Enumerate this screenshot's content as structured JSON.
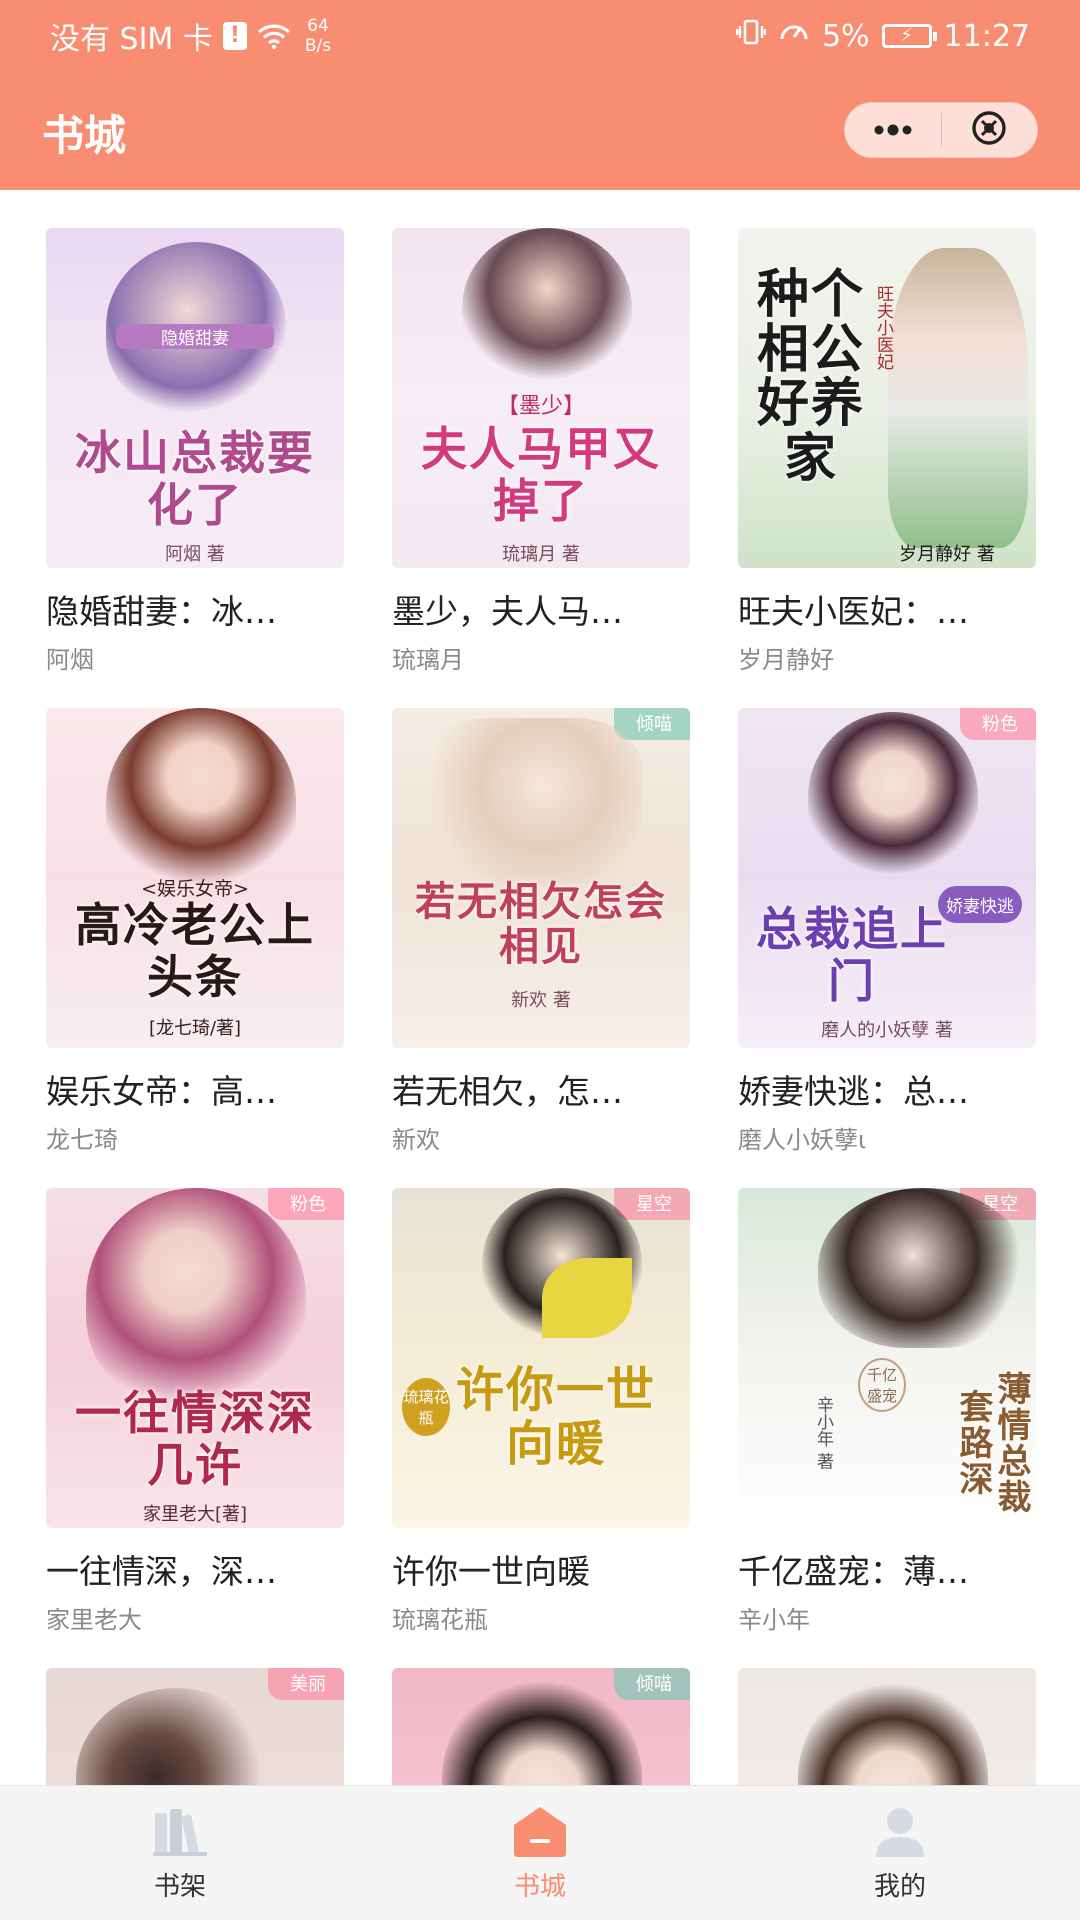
{
  "status_bar": {
    "carrier": "没有 SIM 卡",
    "sim_alert": "!",
    "net_speed_value": "64",
    "net_speed_unit": "B/s",
    "battery_percent": "5%",
    "time": "11:27"
  },
  "header": {
    "title": "书城",
    "more_icon": "more-dots-icon",
    "close_icon": "close-circle-icon"
  },
  "colors": {
    "accent": "#f98d72",
    "title_text": "#222222",
    "author_text": "#8a8a8a"
  },
  "books": [
    {
      "title": "隐婚甜妻：冰…",
      "author": "阿烟",
      "cover_title": "冰山总裁要化了",
      "cover_series": "隐婚甜妻",
      "cover_author": "阿烟 著",
      "cover_tag": ""
    },
    {
      "title": "墨少，夫人马…",
      "author": "琉璃月",
      "cover_title": "夫人马甲又掉了",
      "cover_series": "【墨少】",
      "cover_author": "琉璃月 著",
      "cover_tag": ""
    },
    {
      "title": "旺夫小医妃：…",
      "author": "岁月静好",
      "cover_title": "种个相公好养家",
      "cover_series": "旺夫小医妃",
      "cover_author": "岁月静好 著",
      "cover_tag": ""
    },
    {
      "title": "娱乐女帝：高…",
      "author": "龙七琦",
      "cover_title": "高冷老公上头条",
      "cover_series": "<娱乐女帝>",
      "cover_author": "[龙七琦/著]",
      "cover_tag": ""
    },
    {
      "title": "若无相欠，怎…",
      "author": "新欢",
      "cover_title": "若无相欠怎会相见",
      "cover_series": "",
      "cover_author": "新欢 著",
      "cover_tag": "倾喵"
    },
    {
      "title": "娇妻快逃：总…",
      "author": "磨人小妖孽ι",
      "cover_title": "总裁追上门",
      "cover_series": "娇妻快逃",
      "cover_author": "磨人的小妖孽 著",
      "cover_tag": "粉色"
    },
    {
      "title": "一往情深，深…",
      "author": "家里老大",
      "cover_title": "一往情深深几许",
      "cover_series": "",
      "cover_author": "家里老大[著]",
      "cover_tag": "粉色"
    },
    {
      "title": "许你一世向暖",
      "author": "琉璃花瓶",
      "cover_title": "许你一世向暖",
      "cover_series": "琉璃花瓶",
      "cover_author": "",
      "cover_tag": "星空"
    },
    {
      "title": "千亿盛宠：薄…",
      "author": "辛小年",
      "cover_title": "薄情总裁套路深",
      "cover_series": "千亿盛宠",
      "cover_author": "辛小年 著",
      "cover_tag": "星空"
    },
    {
      "title": "",
      "author": "",
      "cover_title": "",
      "cover_series": "",
      "cover_author": "",
      "cover_tag": "美丽"
    },
    {
      "title": "",
      "author": "",
      "cover_title": "",
      "cover_series": "",
      "cover_author": "",
      "cover_tag": "倾喵"
    },
    {
      "title": "",
      "author": "",
      "cover_title": "",
      "cover_series": "",
      "cover_author": "",
      "cover_tag": ""
    }
  ],
  "tab_bar": {
    "items": [
      {
        "label": "书架",
        "icon": "bookshelf-icon",
        "active": false
      },
      {
        "label": "书城",
        "icon": "bookstore-house-icon",
        "active": true
      },
      {
        "label": "我的",
        "icon": "user-profile-icon",
        "active": false
      }
    ]
  }
}
